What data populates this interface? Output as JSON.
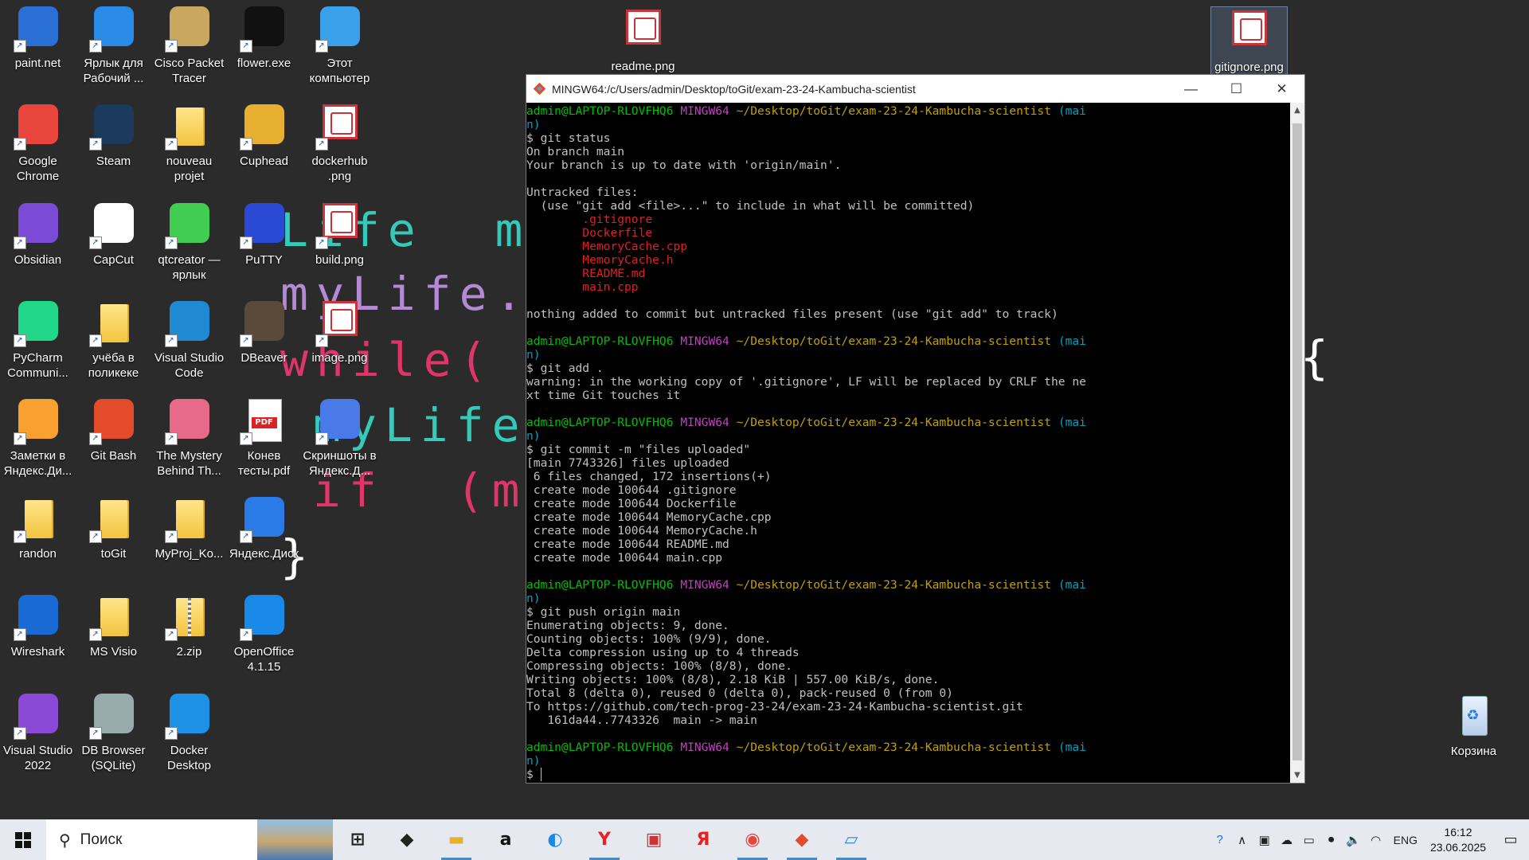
{
  "wallpaper": {
    "lines": [
      "Life  myL",
      "myLife.s",
      "while(",
      "myLife",
      "if  (myL",
      "}",
      "{"
    ]
  },
  "desktop_icons": [
    {
      "label": "paint.net",
      "icon": "paint-net-icon",
      "color": "#2a6fd6"
    },
    {
      "label": "Ярлык для Рабочий ...",
      "icon": "onedrive-icon",
      "color": "#2a8ae8"
    },
    {
      "label": "Cisco Packet Tracer",
      "icon": "cisco-packet-tracer-icon",
      "color": "#c8a860"
    },
    {
      "label": "flower.exe",
      "icon": "flower-exe-icon",
      "color": "#111"
    },
    {
      "label": "Этот компьютер",
      "icon": "this-pc-icon",
      "color": "#3aa0ea"
    },
    {
      "label": "Google Chrome",
      "icon": "chrome-icon",
      "color": "#e8453c"
    },
    {
      "label": "Steam",
      "icon": "steam-icon",
      "color": "#1b3a5c"
    },
    {
      "label": "nouveau projet",
      "icon": "folder-icon",
      "color": "#f3c43f"
    },
    {
      "label": "Cuphead",
      "icon": "cuphead-icon",
      "color": "#e8b030"
    },
    {
      "label": "dockerhub .png",
      "icon": "image-file-icon",
      "color": "#c9343a"
    },
    {
      "label": "Obsidian",
      "icon": "obsidian-icon",
      "color": "#7c4bd6"
    },
    {
      "label": "CapCut",
      "icon": "capcut-icon",
      "color": "#fff"
    },
    {
      "label": "qtcreator — ярлык",
      "icon": "qtcreator-icon",
      "color": "#41cd52"
    },
    {
      "label": "PuTTY",
      "icon": "putty-icon",
      "color": "#2a4ad6"
    },
    {
      "label": "build.png",
      "icon": "image-file-icon",
      "color": "#c9343a"
    },
    {
      "label": "PyCharm Communi...",
      "icon": "pycharm-icon",
      "color": "#21d789"
    },
    {
      "label": "учёба в поликеке",
      "icon": "folder-icon",
      "color": "#f3c43f"
    },
    {
      "label": "Visual Studio Code",
      "icon": "vscode-icon",
      "color": "#1f8ad2"
    },
    {
      "label": "DBeaver",
      "icon": "dbeaver-icon",
      "color": "#5a4a3a"
    },
    {
      "label": "image.png",
      "icon": "image-file-icon",
      "color": "#c9343a"
    },
    {
      "label": "Заметки в Яндекс.Ди...",
      "icon": "yandex-notes-icon",
      "color": "#f8a030"
    },
    {
      "label": "Git Bash",
      "icon": "git-bash-icon",
      "color": "#e44b2a"
    },
    {
      "label": "The Mystery Behind Th...",
      "icon": "mystery-game-icon",
      "color": "#e86a8a"
    },
    {
      "label": "Конев тесты.pdf",
      "icon": "pdf-icon",
      "color": "#d22"
    },
    {
      "label": "Скриншоты в Яндекс.Д...",
      "icon": "yandex-screenshots-icon",
      "color": "#4a7ae8"
    },
    {
      "label": "randon",
      "icon": "folder-icon",
      "color": "#f3c43f"
    },
    {
      "label": "toGit",
      "icon": "folder-icon",
      "color": "#f3c43f"
    },
    {
      "label": "MyProj_Ko...",
      "icon": "folder-icon",
      "color": "#f3c43f"
    },
    {
      "label": "Яндекс.Диск",
      "icon": "yandex-disk-icon",
      "color": "#2a7ae8"
    },
    {
      "label": "Wireshark",
      "icon": "wireshark-icon",
      "color": "#1a6ad6"
    },
    {
      "label": "MS Visio",
      "icon": "folder-icon",
      "color": "#f3c43f"
    },
    {
      "label": "2.zip",
      "icon": "zip-icon",
      "color": "#f3c43f"
    },
    {
      "label": "OpenOffice 4.1.15",
      "icon": "openoffice-icon",
      "color": "#1a8ae8"
    },
    {
      "label": "Visual Studio 2022",
      "icon": "visual-studio-icon",
      "color": "#8a4ad6"
    },
    {
      "label": "DB Browser (SQLite)",
      "icon": "db-browser-icon",
      "color": "#9aa"
    },
    {
      "label": "Docker Desktop",
      "icon": "docker-icon",
      "color": "#1d91e6"
    }
  ],
  "top_icons": [
    {
      "label": "readme.png"
    },
    {
      "label": "gitignore.png"
    }
  ],
  "recycle_bin": {
    "label": "Корзина"
  },
  "terminal": {
    "title": "MINGW64:/c/Users/admin/Desktop/toGit/exam-23-24-Kambucha-scientist",
    "prompt_user": "admin@LAPTOP-RLOVFHQ6",
    "prompt_env": "MINGW64",
    "prompt_path": "~/Desktop/toGit/exam-23-24-Kambucha-scientist",
    "prompt_branch_a": "(mai",
    "prompt_branch_b": "n)",
    "cmd1": "$ git status",
    "status_lines": [
      "On branch main",
      "Your branch is up to date with 'origin/main'.",
      "",
      "Untracked files:",
      "  (use \"git add <file>...\" to include in what will be committed)"
    ],
    "untracked": [
      ".gitignore",
      "Dockerfile",
      "MemoryCache.cpp",
      "MemoryCache.h",
      "README.md",
      "main.cpp"
    ],
    "status_tail": "nothing added to commit but untracked files present (use \"git add\" to track)",
    "cmd2": "$ git add .",
    "add_warning": [
      "warning: in the working copy of '.gitignore', LF will be replaced by CRLF the ne",
      "xt time Git touches it"
    ],
    "cmd3": "$ git commit -m \"files uploaded\"",
    "commit_lines": [
      "[main 7743326] files uploaded",
      " 6 files changed, 172 insertions(+)",
      " create mode 100644 .gitignore",
      " create mode 100644 Dockerfile",
      " create mode 100644 MemoryCache.cpp",
      " create mode 100644 MemoryCache.h",
      " create mode 100644 README.md",
      " create mode 100644 main.cpp"
    ],
    "cmd4": "$ git push origin main",
    "push_lines": [
      "Enumerating objects: 9, done.",
      "Counting objects: 100% (9/9), done.",
      "Delta compression using up to 4 threads",
      "Compressing objects: 100% (8/8), done.",
      "Writing objects: 100% (8/8), 2.18 KiB | 557.00 KiB/s, done.",
      "Total 8 (delta 0), reused 0 (delta 0), pack-reused 0 (from 0)",
      "To https://github.com/tech-prog-23-24/exam-23-24-Kambucha-scientist.git",
      "   161da44..7743326  main -> main"
    ],
    "final_prompt": "$ "
  },
  "taskbar": {
    "search_placeholder": "Поиск",
    "apps": [
      "task-view-icon",
      "dropbox-icon",
      "file-explorer-icon",
      "amazon-icon",
      "edge-icon",
      "yandex-browser-icon",
      "image-viewer-icon",
      "yandex-icon",
      "chrome-icon",
      "git-gui-icon",
      "notepad-icon"
    ],
    "lang": "ENG",
    "time": "16:12",
    "date": "23.06.2025"
  }
}
